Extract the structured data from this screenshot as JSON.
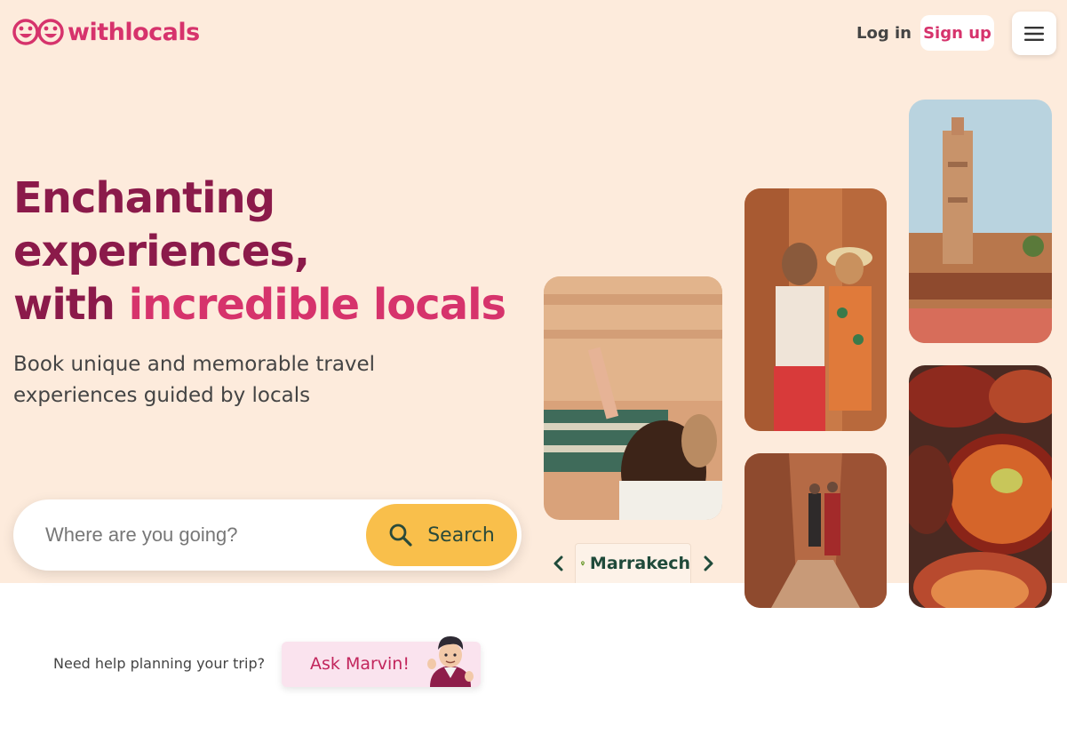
{
  "brand": {
    "name": "withlocals",
    "color": "#d6336c"
  },
  "header": {
    "login_label": "Log in",
    "signup_label": "Sign up",
    "menu_icon": "hamburger-icon"
  },
  "hero": {
    "line1": "Enchanting",
    "line2": "experiences,",
    "line3_prefix": "with ",
    "line3_accent": "incredible locals",
    "subtitle": "Book unique and memorable travel experiences guided by locals"
  },
  "search": {
    "placeholder": "Where are you going?",
    "button_label": "Search"
  },
  "city_picker": {
    "city": "Marrakech"
  },
  "help": {
    "prompt": "Need help planning your trip?",
    "button_label": "Ask Marvin!"
  },
  "colors": {
    "hero_bg": "#fdebdc",
    "headline": "#8b1a4a",
    "accent": "#d6336c",
    "search_button": "#f9bf4b"
  }
}
